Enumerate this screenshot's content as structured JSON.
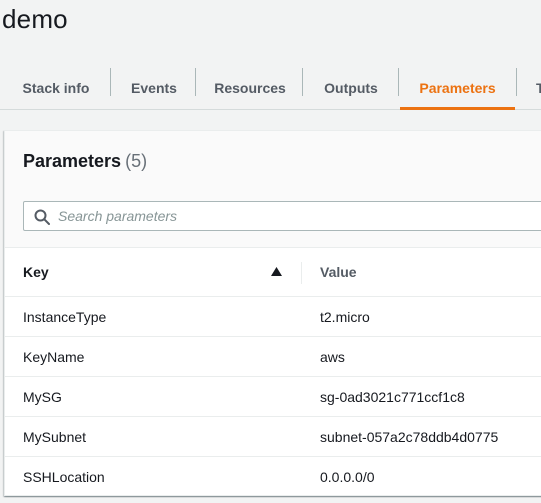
{
  "page": {
    "title": "demo"
  },
  "tabs": [
    {
      "label": "Stack info"
    },
    {
      "label": "Events"
    },
    {
      "label": "Resources"
    },
    {
      "label": "Outputs"
    },
    {
      "label": "Parameters",
      "active": true
    },
    {
      "label": "T"
    }
  ],
  "parameters": {
    "title": "Parameters",
    "count": "(5)",
    "search": {
      "placeholder": "Search parameters",
      "value": ""
    },
    "columns": {
      "key": "Key",
      "value": "Value"
    },
    "sort": {
      "column": "Key",
      "direction": "ascending"
    },
    "rows": [
      {
        "key": "InstanceType",
        "value": "t2.micro"
      },
      {
        "key": "KeyName",
        "value": "aws"
      },
      {
        "key": "MySG",
        "value": "sg-0ad3021c771ccf1c8"
      },
      {
        "key": "MySubnet",
        "value": "subnet-057a2c78ddb4d0775"
      },
      {
        "key": "SSHLocation",
        "value": "0.0.0.0/0"
      }
    ]
  },
  "icons": {
    "search": "search-icon",
    "sort": "sort-ascending-icon"
  },
  "colors": {
    "accent": "#ec7211",
    "text": "#16191f",
    "muted": "#545b64",
    "background": "#f2f3f3"
  }
}
